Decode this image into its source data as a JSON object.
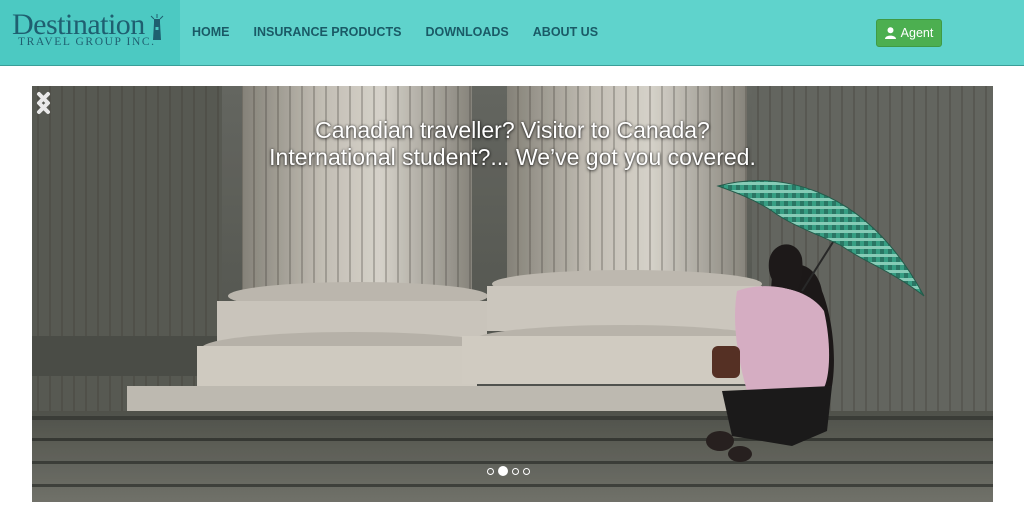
{
  "brand": {
    "name": "Destination",
    "subtitle": "TRAVEL GROUP INC."
  },
  "nav": {
    "items": [
      "HOME",
      "INSURANCE PRODUCTS",
      "DOWNLOADS",
      "ABOUT US"
    ]
  },
  "agent_button": {
    "label": "Agent",
    "icon": "user-icon"
  },
  "hero": {
    "headline_line1": "Canadian traveller? Visitor to Canada?",
    "headline_line2": "International student?... We’ve got you covered.",
    "slide_count": 4,
    "active_slide": 2
  },
  "colors": {
    "navbar": "#5fd3cc",
    "brand_text": "#1f5f70",
    "agent_button": "#4caf50"
  }
}
